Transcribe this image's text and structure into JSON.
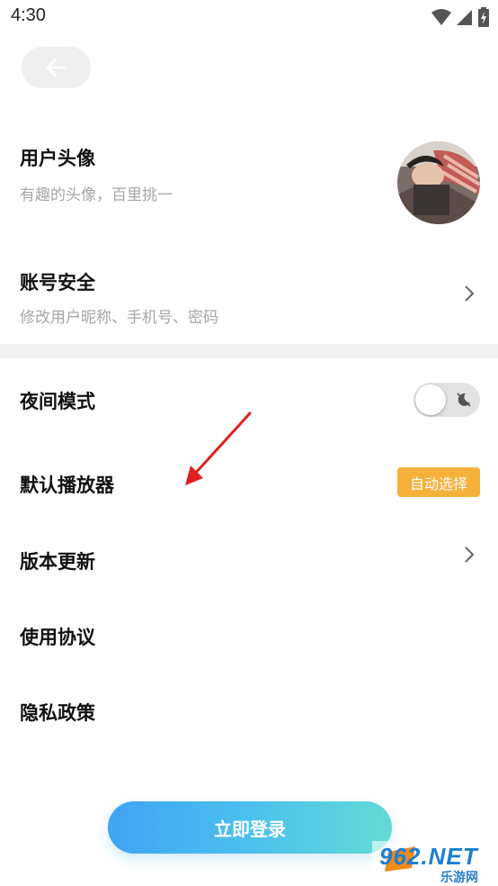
{
  "status_bar": {
    "time": "4:30"
  },
  "profile": {
    "avatar_title": "用户头像",
    "avatar_subtitle": "有趣的头像，百里挑一",
    "account_title": "账号安全",
    "account_subtitle": "修改用户昵称、手机号、密码"
  },
  "settings": {
    "night_mode": "夜间模式",
    "default_player": "默认播放器",
    "default_player_value": "自动选择",
    "version_update": "版本更新",
    "terms": "使用协议",
    "privacy": "隐私政策"
  },
  "login_button": "立即登录",
  "watermark": {
    "brand": "962.NET",
    "sub": "乐游网"
  },
  "colors": {
    "accent_gradient_start": "#3ea3f5",
    "accent_gradient_end": "#63dad6",
    "badge": "#f6b13a",
    "annotation_arrow": "#e02020"
  },
  "icons": [
    "wifi-icon",
    "signal-icon",
    "battery-charging-icon",
    "back-arrow-icon",
    "chevron-right-icon",
    "night-mode-off-icon"
  ]
}
